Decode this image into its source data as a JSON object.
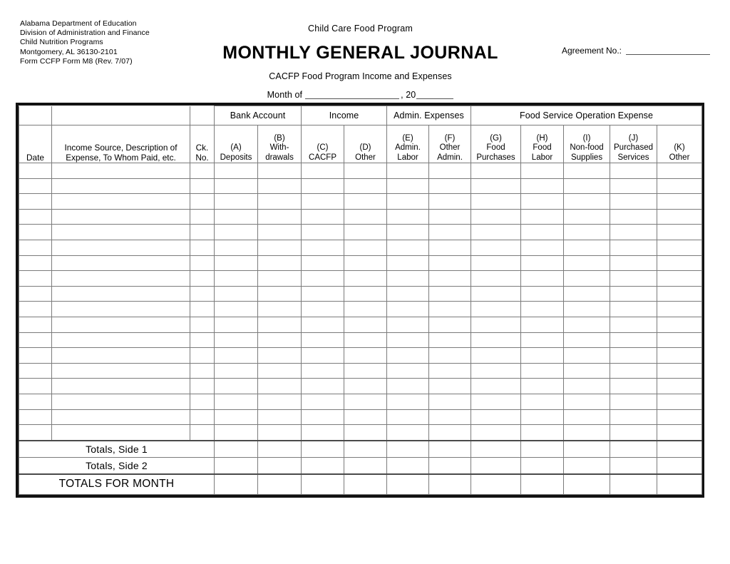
{
  "header": {
    "agency_lines": [
      "Alabama Department of Education",
      "Division of Administration and Finance",
      "Child Nutrition Programs",
      "Montgomery, AL 36130-2101",
      "Form CCFP Form M8 (Rev. 7/07)"
    ],
    "program_name": "Child Care Food Program",
    "title": "MONTHLY GENERAL JOURNAL",
    "subtitle": "CACFP Food Program Income and Expenses",
    "month_label": "Month of",
    "year_prefix": ", 20",
    "agreement_label": "Agreement No.:"
  },
  "table": {
    "groups": [
      {
        "label": "",
        "span": 3
      },
      {
        "label": "Bank Account",
        "span": 2
      },
      {
        "label": "Income",
        "span": 2
      },
      {
        "label": "Admin. Expenses",
        "span": 2
      },
      {
        "label": "Food Service Operation Expense",
        "span": 5
      }
    ],
    "columns": [
      {
        "code": "",
        "label": "Date"
      },
      {
        "code": "",
        "label": "Income Source, Description of Expense, To Whom Paid, etc."
      },
      {
        "code": "",
        "label": "Ck. No."
      },
      {
        "code": "(A)",
        "label": "Deposits"
      },
      {
        "code": "(B)",
        "label": "With- drawals"
      },
      {
        "code": "(C)",
        "label": "CACFP"
      },
      {
        "code": "(D)",
        "label": "Other"
      },
      {
        "code": "(E)",
        "label": "Admin. Labor"
      },
      {
        "code": "(F)",
        "label": "Other Admin."
      },
      {
        "code": "(G)",
        "label": "Food Purchases"
      },
      {
        "code": "(H)",
        "label": "Food Labor"
      },
      {
        "code": "(I)",
        "label": "Non-food Supplies"
      },
      {
        "code": "(J)",
        "label": "Purchased Services"
      },
      {
        "code": "(K)",
        "label": "Other"
      }
    ],
    "column_headers_parts": {
      "date": "Date",
      "description_line1": "Income Source, Description of",
      "description_line2": "Expense, To Whom Paid, etc.",
      "ck_line1": "Ck.",
      "ck_line2": "No.",
      "a_code": "(A)",
      "a_label": "Deposits",
      "b_code": "(B)",
      "b_label1": "With-",
      "b_label2": "drawals",
      "c_code": "(C)",
      "c_label": "CACFP",
      "d_code": "(D)",
      "d_label": "Other",
      "e_code": "(E)",
      "e_label1": "Admin.",
      "e_label2": "Labor",
      "f_code": "(F)",
      "f_label1": "Other",
      "f_label2": "Admin.",
      "g_code": "(G)",
      "g_label1": "Food",
      "g_label2": "Purchases",
      "h_code": "(H)",
      "h_label1": "Food",
      "h_label2": "Labor",
      "i_code": "(I)",
      "i_label1": "Non-food",
      "i_label2": "Supplies",
      "j_code": "(J)",
      "j_label1": "Purchased",
      "j_label2": "Services",
      "k_code": "(K)",
      "k_label": "Other"
    },
    "group_labels": {
      "bank_account": "Bank Account",
      "income": "Income",
      "admin_expenses": "Admin. Expenses",
      "food_service": "Food Service Operation Expense"
    },
    "body_row_count": 18,
    "totals": {
      "side1": "Totals, Side 1",
      "side2": "Totals, Side 2",
      "month": "TOTALS FOR MONTH"
    }
  },
  "colors": {
    "outer_border": "#111111",
    "grid_line": "#7b7b7b",
    "rule_line": "#555555",
    "text": "#000000"
  }
}
